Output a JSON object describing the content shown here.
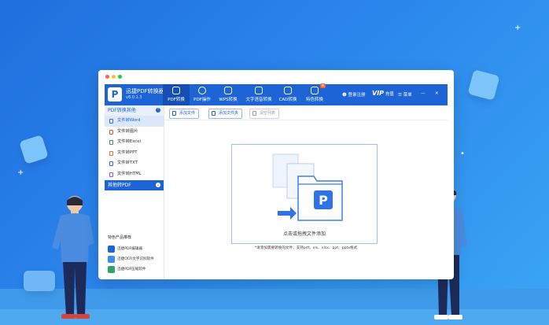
{
  "app": {
    "name": "迅捷PDF转换器",
    "version": "v8.0.1.3"
  },
  "nav": [
    {
      "label": "PDF转换",
      "icon": "convert-icon",
      "active": true
    },
    {
      "label": "PDF操作",
      "icon": "pdf-ops-icon",
      "active": false
    },
    {
      "label": "WPS转换",
      "icon": "wps-icon",
      "active": false
    },
    {
      "label": "文字语音转换",
      "icon": "speech-icon",
      "active": false
    },
    {
      "label": "CAD转换",
      "icon": "cad-icon",
      "active": false
    },
    {
      "label": "特色转换",
      "icon": "special-icon",
      "active": false
    }
  ],
  "header_right": {
    "login": "登录注册",
    "vip_logo": "VIP",
    "vip_label": "充值",
    "menu": "菜单"
  },
  "sidebar": {
    "group1": "PDF转换其他",
    "items": [
      "文件转Word",
      "文件转图片",
      "文件转Excel",
      "文件转PPT",
      "文件转TXT",
      "文件转HTML"
    ],
    "group2": "其他转PDF",
    "promo_title": "特色产品推荐",
    "promos": [
      "迅捷PDF编辑器",
      "迅捷OCR文字识别软件",
      "迅捷PDF压缩软件"
    ]
  },
  "toolbar": {
    "add_file": "添加文件",
    "add_folder": "添加文件夹",
    "clear_list": "清空列表"
  },
  "dropzone": {
    "label": "点击或拖拽文件添加",
    "hint": "*请添加需要转换的文件，支持pdf、xls、xlsx、ppt、pptx格式"
  },
  "colors": {
    "brand": "#1d64d6",
    "background": "#2b86ec"
  }
}
